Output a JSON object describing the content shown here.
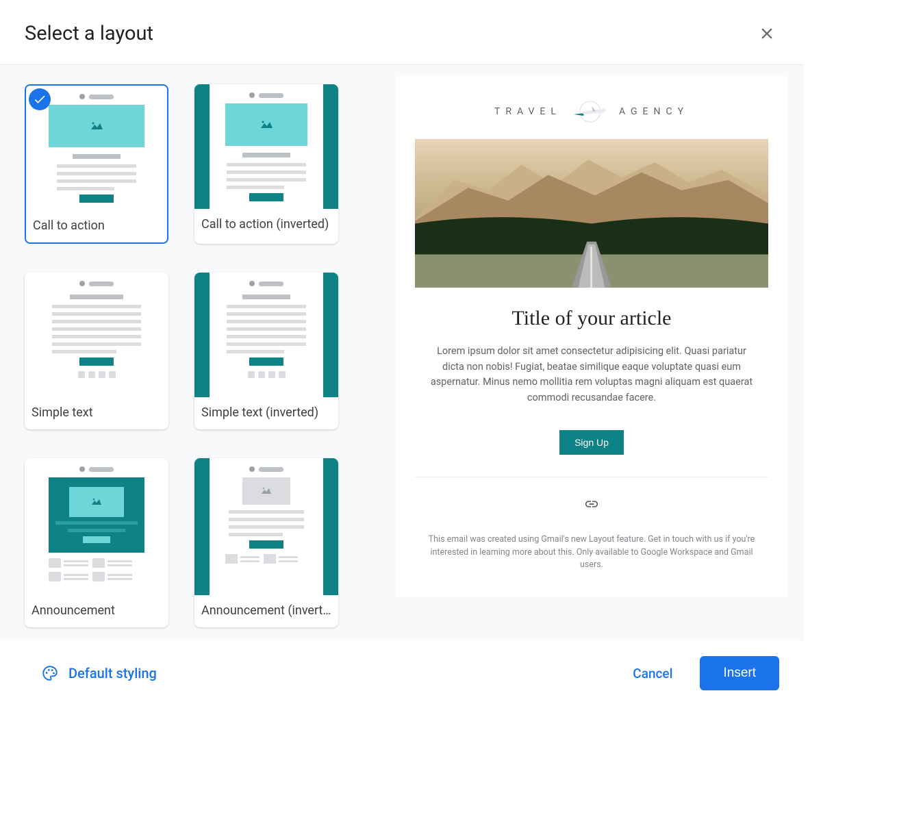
{
  "header": {
    "title": "Select a layout"
  },
  "layouts": [
    {
      "label": "Call to action",
      "selected": true
    },
    {
      "label": "Call to action (inverted)",
      "selected": false
    },
    {
      "label": "Simple text",
      "selected": false
    },
    {
      "label": "Simple text (inverted)",
      "selected": false
    },
    {
      "label": "Announcement",
      "selected": false
    },
    {
      "label": "Announcement (inverted)",
      "selected": false
    }
  ],
  "preview": {
    "logo_left": "TRAVEL",
    "logo_right": "AGENCY",
    "title": "Title of your article",
    "body": "Lorem ipsum dolor sit amet consectetur adipisicing elit. Quasi pariatur dicta non nobis! Fugiat, beatae similique eaque voluptate quasi eum aspernatur. Minus nemo mollitia rem voluptas magni aliquam est quaerat commodi recusandae facere.",
    "cta": "Sign Up",
    "footer": "This email was created using Gmail's new Layout feature. Get in touch with us if you're interested in learning more about this. Only available to Google Workspace and Gmail users."
  },
  "footer": {
    "styling": "Default styling",
    "cancel": "Cancel",
    "insert": "Insert"
  },
  "colors": {
    "primary": "#1a73e8",
    "teal": "#0e8287",
    "teal_light": "#6ed6d8"
  }
}
